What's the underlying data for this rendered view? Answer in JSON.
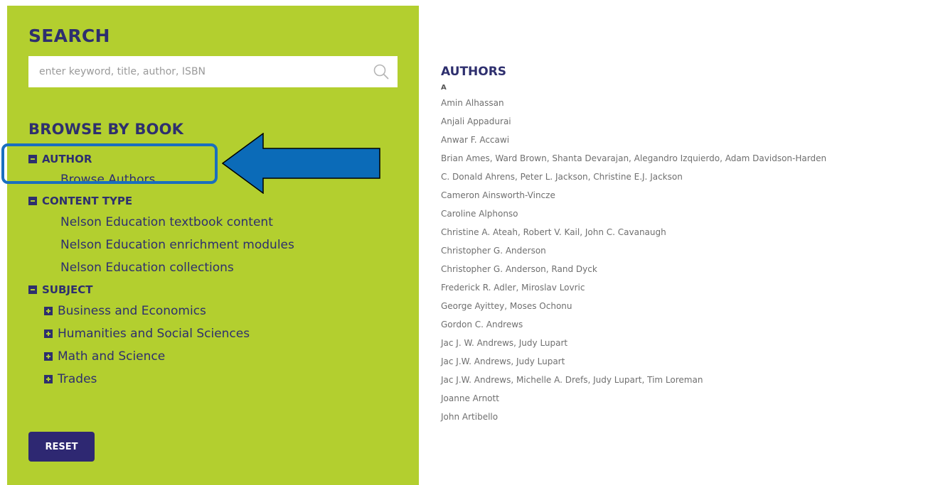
{
  "search": {
    "title": "SEARCH",
    "placeholder": "enter keyword, title, author, ISBN"
  },
  "browse": {
    "title": "BROWSE BY BOOK",
    "author_section": {
      "label": "AUTHOR",
      "links": [
        "Browse Authors"
      ]
    },
    "content_type_section": {
      "label": "CONTENT TYPE",
      "links": [
        "Nelson Education textbook content",
        "Nelson Education enrichment modules",
        "Nelson Education collections"
      ]
    },
    "subject_section": {
      "label": "SUBJECT",
      "items": [
        "Business and Economics",
        "Humanities and Social Sciences",
        "Math and Science",
        "Trades"
      ]
    }
  },
  "reset_label": "RESET",
  "authors": {
    "title": "AUTHORS",
    "letter": "A",
    "items": [
      "Amin Alhassan",
      "Anjali Appadurai",
      "Anwar F. Accawi",
      "Brian Ames, Ward Brown, Shanta Devarajan, Alegandro Izquierdo, Adam Davidson-Harden",
      "C. Donald Ahrens, Peter L. Jackson, Christine E.J. Jackson",
      "Cameron Ainsworth-Vincze",
      "Caroline Alphonso",
      "Christine A. Ateah, Robert V. Kail, John C. Cavanaugh",
      "Christopher G. Anderson",
      "Christopher G. Anderson, Rand Dyck",
      "Frederick R. Adler, Miroslav Lovric",
      "George Ayittey, Moses Ochonu",
      "Gordon C. Andrews",
      "Jac J. W. Andrews, Judy Lupart",
      "Jac J.W. Andrews, Judy Lupart",
      "Jac J.W. Andrews, Michelle A. Drefs, Judy Lupart, Tim Loreman",
      "Joanne Arnott",
      "John Artibello"
    ]
  },
  "colors": {
    "sidebar_bg": "#b3cf2f",
    "navy": "#2e2f6e",
    "highlight_blue": "#1a6fbf",
    "author_text": "#6f6f6f"
  },
  "icons": {
    "search": "search-icon",
    "collapse": "minus-square-icon",
    "expand": "plus-square-icon",
    "annotation_arrow": "left-arrow-icon"
  }
}
